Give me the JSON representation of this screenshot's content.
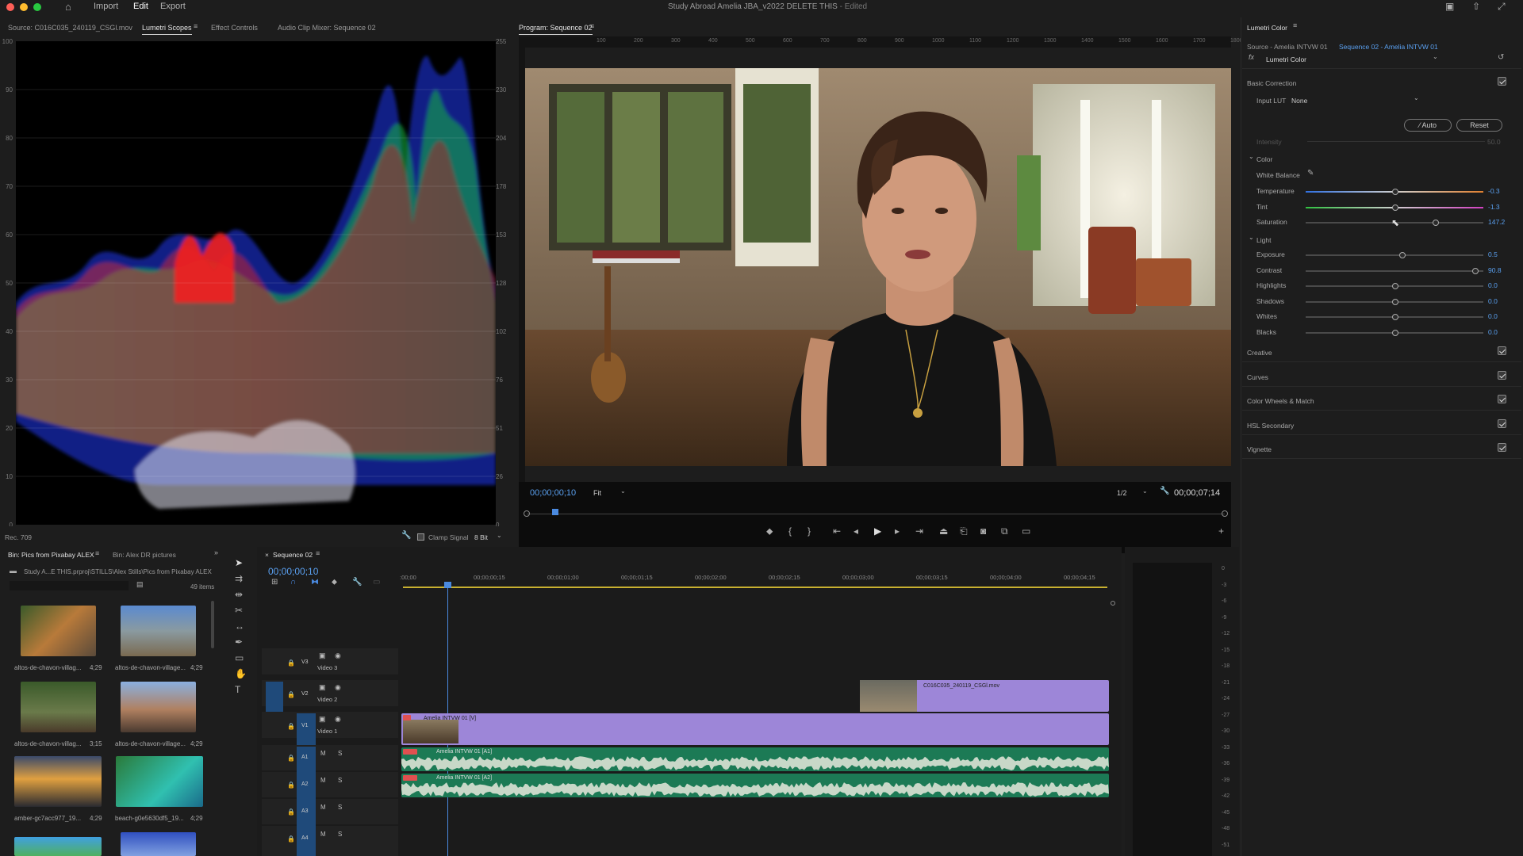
{
  "window": {
    "title": "Study Abroad Amelia JBA_v2022 DELETE THIS",
    "edited": " - Edited"
  },
  "menu": {
    "import": "Import",
    "edit": "Edit",
    "export": "Export"
  },
  "left_tabs": {
    "source": "Source: C016C035_240119_CSGl.mov",
    "scopes": "Lumetri Scopes",
    "effects": "Effect Controls",
    "mixer": "Audio Clip Mixer: Sequence 02"
  },
  "scope": {
    "left_scale": [
      "100",
      "90",
      "80",
      "70",
      "60",
      "50",
      "40",
      "30",
      "20",
      "10",
      "0"
    ],
    "right_scale": [
      "255",
      "230",
      "204",
      "178",
      "153",
      "128",
      "102",
      "76",
      "51",
      "26",
      "0"
    ],
    "footer_left": "Rec. 709",
    "clamp": "Clamp Signal",
    "bits": "8 Bit"
  },
  "program": {
    "title": "Program: Sequence 02",
    "timecode": "00;00;00;10",
    "fit": "Fit",
    "resolution": "1/2",
    "duration": "00;00;07;14",
    "ruler": [
      "100",
      "200",
      "300",
      "400",
      "500",
      "600",
      "700",
      "800",
      "900",
      "1000",
      "1100",
      "1200",
      "1300",
      "1400",
      "1500",
      "1600",
      "1700",
      "1800"
    ]
  },
  "lumetri": {
    "title": "Lumetri Color",
    "source": "Source - Amelia INTVW 01",
    "sequence": "Sequence 02 - Amelia INTVW 01",
    "effect": "Lumetri Color",
    "basic": "Basic Correction",
    "input_lut_label": "Input LUT",
    "input_lut_value": "None",
    "auto": "Auto",
    "reset": "Reset",
    "intensity": "Intensity",
    "intensity_val": "50.0",
    "color": "Color",
    "wb": "White Balance",
    "light": "Light",
    "sliders_color": [
      {
        "label": "Temperature",
        "value": "-0.3"
      },
      {
        "label": "Tint",
        "value": "-1.3"
      },
      {
        "label": "Saturation",
        "value": "147.2"
      }
    ],
    "sliders_light": [
      {
        "label": "Exposure",
        "value": "0.5"
      },
      {
        "label": "Contrast",
        "value": "90.8"
      },
      {
        "label": "Highlights",
        "value": "0.0"
      },
      {
        "label": "Shadows",
        "value": "0.0"
      },
      {
        "label": "Whites",
        "value": "0.0"
      },
      {
        "label": "Blacks",
        "value": "0.0"
      }
    ],
    "sections": [
      "Creative",
      "Curves",
      "Color Wheels & Match",
      "HSL Secondary",
      "Vignette"
    ]
  },
  "bin": {
    "tab1": "Bin: Pics from Pixabay ALEX",
    "tab2": "Bin: Alex DR pictures",
    "path": "Study A...E THIS.prproj\\STILLS\\Alex Stills\\Pics from Pixabay ALEX",
    "count": "49 items",
    "items": [
      {
        "name": "altos-de-chavon-villag...",
        "dur": "4;29"
      },
      {
        "name": "altos-de-chavon-village...",
        "dur": "4;29"
      },
      {
        "name": "altos-de-chavon-villag...",
        "dur": "3;15"
      },
      {
        "name": "altos-de-chavon-village...",
        "dur": "4;29"
      },
      {
        "name": "amber-gc7acc977_19...",
        "dur": "4;29"
      },
      {
        "name": "beach-g0e5630df5_19...",
        "dur": "4;29"
      }
    ]
  },
  "timeline": {
    "tab": "Sequence 02",
    "timecode": "00;00;00;10",
    "ruler": [
      ":00;00",
      "00;00;00;15",
      "00;00;01;00",
      "00;00;01;15",
      "00;00;02;00",
      "00;00;02;15",
      "00;00;03;00",
      "00;00;03;15",
      "00;00;04;00",
      "00;00;04;15"
    ],
    "tracks": {
      "v3": "V3",
      "v2": "V2",
      "v1": "V1",
      "video3": "Video 3",
      "video2": "Video 2",
      "video1": "Video 1",
      "a1": "A1",
      "a2": "A2",
      "a3": "A3",
      "a4": "A4",
      "m": "M",
      "s": "S"
    },
    "clips": {
      "v2": "C016C035_240119_CSGl.mov",
      "v1": "Amelia INTVW 01 [V]",
      "a1": "Amelia INTVW 01 [A1]",
      "a2": "Amelia INTVW 01 [A2]"
    }
  },
  "meter_scale": [
    "0",
    "-3",
    "-6",
    "-9",
    "-12",
    "-15",
    "-18",
    "-21",
    "-24",
    "-27",
    "-30",
    "-33",
    "-36",
    "-39",
    "-42",
    "-45",
    "-48",
    "-51"
  ],
  "colors": {
    "accent": "#5aa0f0",
    "clip_purple": "#9d86d8",
    "audio_green": "#1c7a55"
  }
}
